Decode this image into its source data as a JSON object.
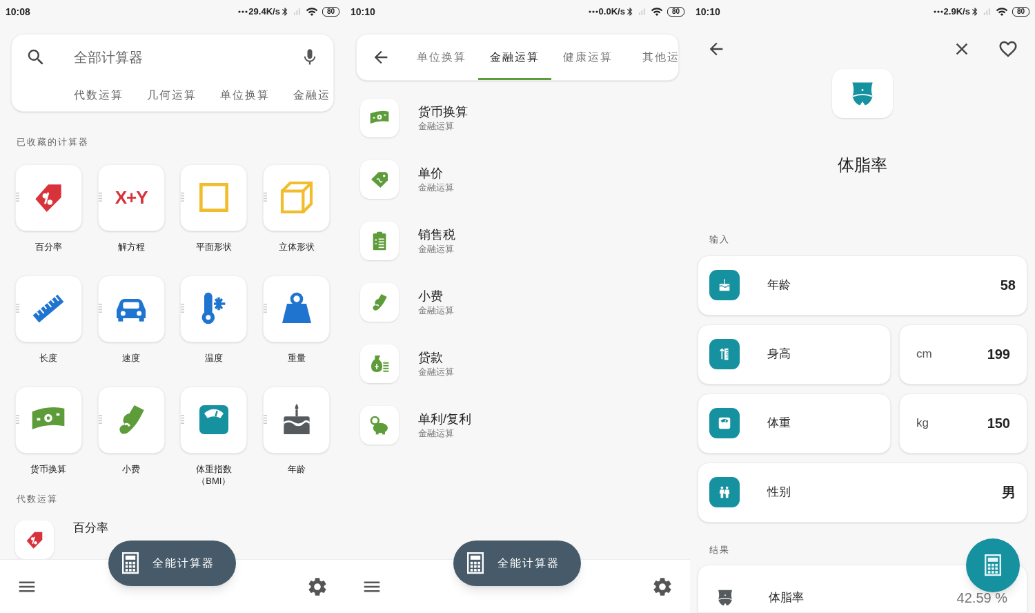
{
  "home": {
    "status_bar": {
      "time": "10:08",
      "speed": "29.4K/s",
      "battery": "80"
    },
    "search": {
      "placeholder": "全部计算器"
    },
    "categories": [
      "代数运算",
      "几何运算",
      "单位换算",
      "金融运"
    ],
    "favorites_title": "已收藏的计算器",
    "favorites": [
      {
        "label": "百分率",
        "kind": "tag",
        "color": "#d8323a"
      },
      {
        "label": "解方程",
        "kind": "glyph",
        "glyph": "X+Y",
        "color": "#d8323a"
      },
      {
        "label": "平面形状",
        "kind": "square",
        "color": "#f2bd2c"
      },
      {
        "label": "立体形状",
        "kind": "cube",
        "color": "#f2bd2c"
      },
      {
        "label": "长度",
        "kind": "ruler",
        "color": "#1f74d0"
      },
      {
        "label": "速度",
        "kind": "car",
        "color": "#1f74d0"
      },
      {
        "label": "温度",
        "kind": "thermometer",
        "color": "#1f74d0"
      },
      {
        "label": "重量",
        "kind": "weight",
        "color": "#1f74d0"
      },
      {
        "label": "货币换算",
        "kind": "money",
        "color": "#5e9c3a"
      },
      {
        "label": "小费",
        "kind": "hand",
        "color": "#5e9c3a"
      },
      {
        "label": "体重指数（BMI）",
        "kind": "scale",
        "color": "#16919f"
      },
      {
        "label": "年龄",
        "kind": "cake",
        "color": "#555a5e"
      }
    ],
    "section_title": "代数运算",
    "list": [
      {
        "title": "百分率",
        "kind": "tag",
        "color": "#d8323a"
      }
    ],
    "fab_label": "全能计算器"
  },
  "category": {
    "status_bar": {
      "time": "10:10",
      "speed": "0.0K/s",
      "battery": "80"
    },
    "tabs": [
      {
        "label": "单位换算",
        "selected": false
      },
      {
        "label": "金融运算",
        "selected": true
      },
      {
        "label": "健康运算",
        "selected": false
      },
      {
        "label": "其他运",
        "selected": false
      }
    ],
    "items": [
      {
        "title": "货币换算",
        "subtitle": "金融运算",
        "kind": "money"
      },
      {
        "title": "单价",
        "subtitle": "金融运算",
        "kind": "pricetag"
      },
      {
        "title": "销售税",
        "subtitle": "金融运算",
        "kind": "clipboard"
      },
      {
        "title": "小费",
        "subtitle": "金融运算",
        "kind": "hand"
      },
      {
        "title": "贷款",
        "subtitle": "金融运算",
        "kind": "moneybag"
      },
      {
        "title": "单利/复利",
        "subtitle": "金融运算",
        "kind": "piggy"
      }
    ],
    "fab_label": "全能计算器"
  },
  "detail": {
    "status_bar": {
      "time": "10:10",
      "speed": "2.9K/s",
      "battery": "80"
    },
    "title": "体脂率",
    "input_title": "输入",
    "fields": [
      {
        "label": "年龄",
        "value": "58",
        "kind": "cake"
      },
      {
        "label": "身高",
        "unit": "cm",
        "value": "199",
        "kind": "height"
      },
      {
        "label": "体重",
        "unit": "kg",
        "value": "150",
        "kind": "scale"
      },
      {
        "label": "性别",
        "value": "男",
        "kind": "people"
      }
    ],
    "result_title": "结果",
    "results": [
      {
        "label": "体脂率",
        "value": "42.59 %"
      }
    ]
  }
}
